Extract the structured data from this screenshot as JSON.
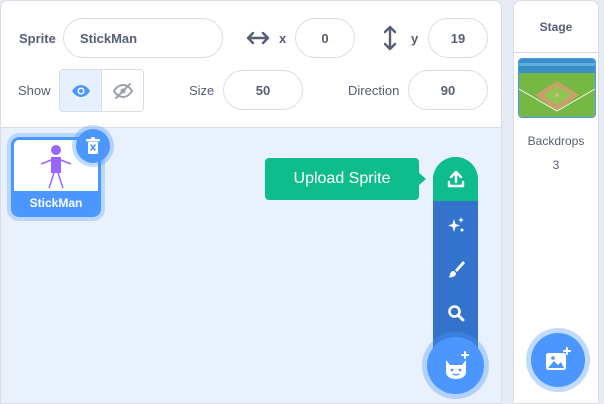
{
  "sprite_info": {
    "sprite_label": "Sprite",
    "sprite_name": "StickMan",
    "x_label": "x",
    "x_value": "0",
    "y_label": "y",
    "y_value": "19",
    "show_label": "Show",
    "size_label": "Size",
    "size_value": "50",
    "direction_label": "Direction",
    "direction_value": "90"
  },
  "sprites": [
    {
      "name": "StickMan"
    }
  ],
  "sprite_menu": {
    "tooltip": "Upload Sprite",
    "items": [
      "upload-icon",
      "surprise-icon",
      "paint-icon",
      "search-icon"
    ],
    "main_icon": "cat-icon"
  },
  "stage": {
    "header": "Stage",
    "backdrops_label": "Backdrops",
    "backdrops_count": "3"
  },
  "colors": {
    "accent": "#4c97ff",
    "menu": "#3373cc",
    "upload": "#0fbd8c"
  }
}
